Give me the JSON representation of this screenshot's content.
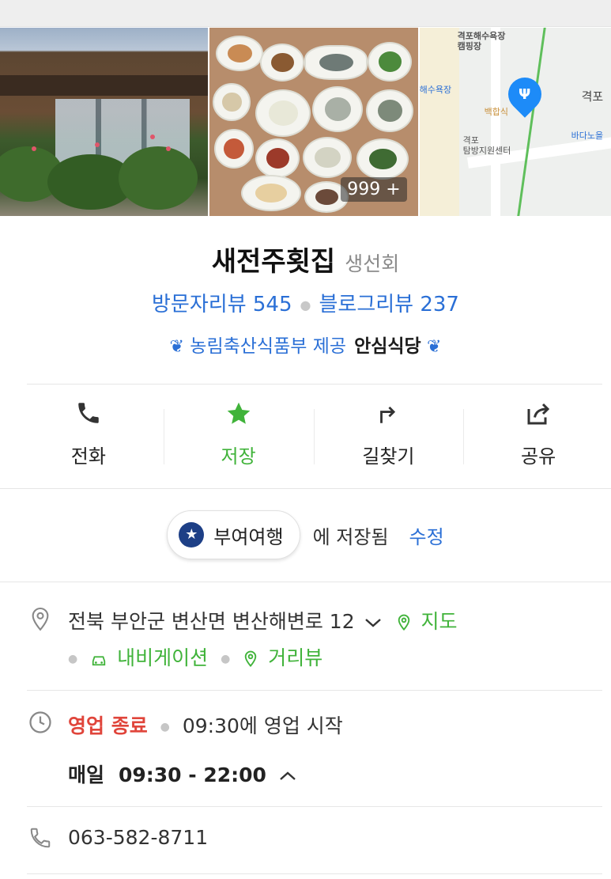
{
  "photos": {
    "count_badge": "999 +",
    "map_labels": {
      "campsite": "격포해수욕장\n캠핑장",
      "beach": "해수욕장",
      "baekhap": "백합식",
      "gyeokpo": "격포",
      "exploration": "격포\n탐방지원센터",
      "sea_road": "바다노을"
    }
  },
  "place": {
    "name": "새전주횟집",
    "category": "생선회",
    "visitor_reviews": "방문자리뷰 545",
    "blog_reviews": "블로그리뷰 237",
    "cert_source": "농림축산식품부 제공",
    "cert_name": "안심식당"
  },
  "actions": [
    {
      "label": "전화",
      "icon": "phone-icon"
    },
    {
      "label": "저장",
      "icon": "star-icon"
    },
    {
      "label": "길찾기",
      "icon": "directions-icon"
    },
    {
      "label": "공유",
      "icon": "share-icon"
    }
  ],
  "saved": {
    "folder": "부여여행",
    "suffix": "에 저장됨",
    "edit": "수정"
  },
  "address": {
    "text": "전북 부안군 변산면 변산해변로 12",
    "map": "지도",
    "navigation": "내비게이션",
    "streetview": "거리뷰"
  },
  "hours": {
    "status": "영업 종료",
    "next": "09:30에 영업 시작",
    "day": "매일",
    "range": "09:30 - 22:00"
  },
  "phone": "063-582-8711",
  "colors": {
    "accent_blue": "#2a6fd6",
    "accent_green": "#40b33a",
    "closed_red": "#e0453b",
    "pin_blue": "#1d8bf8"
  }
}
